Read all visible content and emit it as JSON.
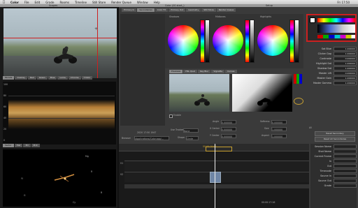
{
  "menubar": {
    "app": "Color",
    "items": [
      "File",
      "Edit",
      "Grade",
      "Rooms",
      "Timeline",
      "Still Store",
      "Render Queue",
      "Window",
      "Help"
    ],
    "clock": "Fri 17:50"
  },
  "window": {
    "title": "Color (00 start_)",
    "left_title": "Scopes",
    "right_title": "Setup"
  },
  "scopes": {
    "tabs": [
      "Parade",
      "Overlay",
      "Red",
      "Green",
      "Blue",
      "Luma",
      "Chroma",
      "Y'CbCr"
    ],
    "lower_tabs": [
      "Vector",
      "Hist",
      "3D",
      "Pick"
    ],
    "scale": [
      "100",
      "80",
      "60",
      "40",
      "20",
      "0"
    ],
    "vector_labels": [
      "Mg",
      "R",
      "Yl",
      "G",
      "Cy",
      "B"
    ]
  },
  "primary": {
    "tabs": [
      "Primary In",
      "Secondaries",
      "Color FX",
      "Primary Out",
      "Geometry",
      "Still Store",
      "Render Queue"
    ],
    "panels": [
      "Shadows",
      "Midtones",
      "Highlights"
    ],
    "basic_label": "Basic",
    "advanced_label": "Advanced",
    "curves_label": "Curves",
    "controls": [
      {
        "label": "Sat Blue",
        "value": "1.000000"
      },
      {
        "label": "Clicker Gap",
        "value": "1.000000"
      },
      {
        "label": "Contraste",
        "value": "0.000000"
      },
      {
        "label": "Highlight Sat",
        "value": "1.000000"
      },
      {
        "label": "Shadow Sat",
        "value": "1.000000"
      },
      {
        "label": "Master Lift",
        "value": "0.000000"
      },
      {
        "label": "Master Gain",
        "value": "1.000000"
      },
      {
        "label": "Master Gamma",
        "value": "1.000000"
      }
    ]
  },
  "secondary": {
    "tabs": [
      "Previews",
      "HSL Qual",
      "Key Blur",
      "Vignette",
      "Curves"
    ],
    "enable_label": "Enable",
    "fields": [
      {
        "label": "Angle",
        "value": "0.000000"
      },
      {
        "label": "Softness",
        "value": "0.000000"
      },
      {
        "label": "X Center",
        "value": "0.000000"
      },
      {
        "label": "Size",
        "value": "1.000000"
      },
      {
        "label": "Y Center",
        "value": "0.000000"
      },
      {
        "label": "Aspect",
        "value": "1.000000"
      }
    ],
    "use_tracker_label": "Use Tracker",
    "use_tracker_value": "None",
    "shape_label": "Shape",
    "shape_value": "Circle",
    "browser_label": "Browser",
    "browser_path": "/Applications/Color.app/..."
  },
  "grade": {
    "all_label": "All",
    "reset_buttons": [
      "Reset Secondary",
      "Reset All Secondaries"
    ],
    "side_labels": [
      "Session Name",
      "Shot Name",
      "Current Frame",
      "In",
      "Out",
      "Timecode",
      "Source In",
      "Source Out",
      "Grade"
    ]
  },
  "timeline": {
    "ruler": "00:00:10:00",
    "tracks": [
      "V1",
      "V2"
    ],
    "timecode": "00:00:17:16"
  },
  "viewer": {
    "tc": "2020 17:50 1947"
  },
  "colors": {
    "accent_red": "#cc2020",
    "playhead": "#f0f0f0",
    "clip": "#6f86a6"
  }
}
